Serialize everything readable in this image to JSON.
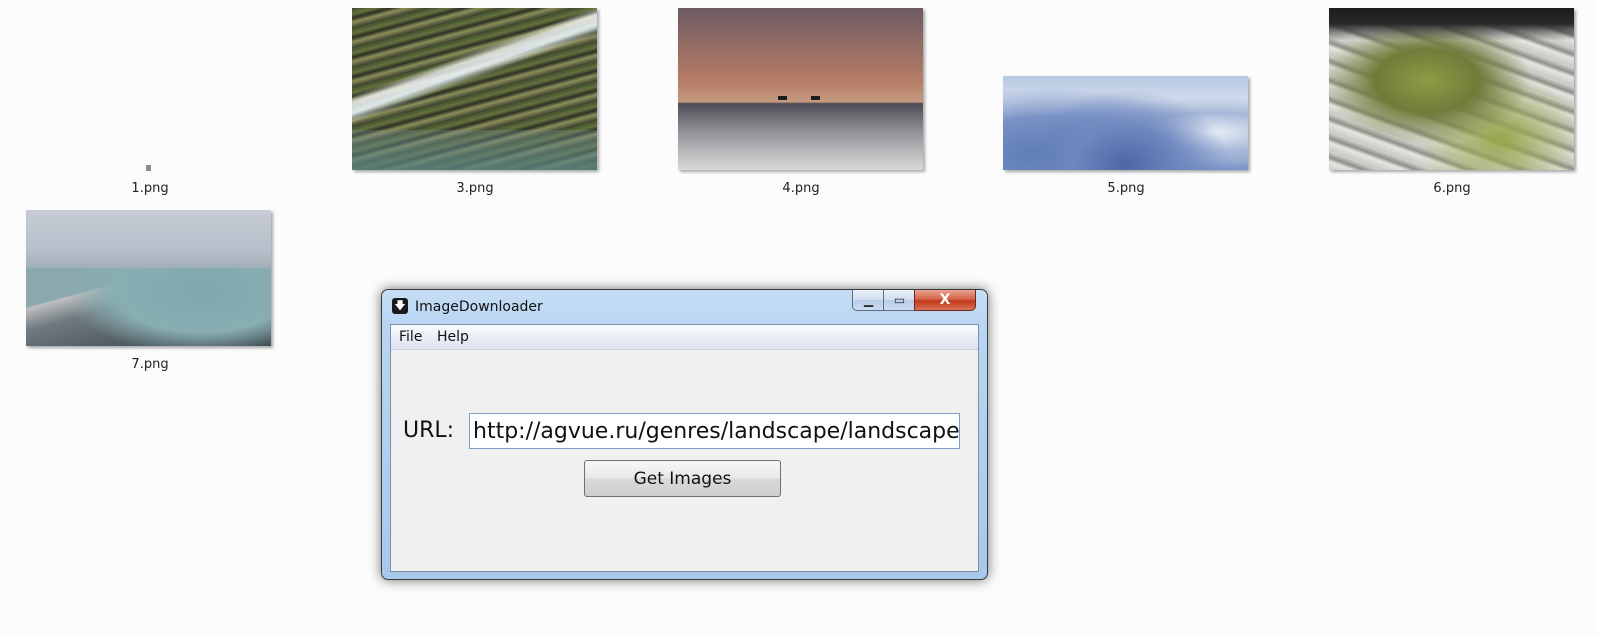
{
  "desktop": {
    "files": [
      {
        "label": "1.png"
      },
      {
        "label": "3.png"
      },
      {
        "label": "4.png"
      },
      {
        "label": "5.png"
      },
      {
        "label": "6.png"
      },
      {
        "label": "7.png"
      }
    ]
  },
  "window": {
    "title": "ImageDownloader",
    "icon": "download-arrow-icon",
    "controls": {
      "minimize": "▁",
      "maximize": "▭",
      "close": "X"
    },
    "menu": {
      "file": "File",
      "help": "Help"
    },
    "form": {
      "url_label": "URL:",
      "url_value": "http://agvue.ru/genres/landscape/landscape.l",
      "button_label": "Get Images"
    }
  }
}
